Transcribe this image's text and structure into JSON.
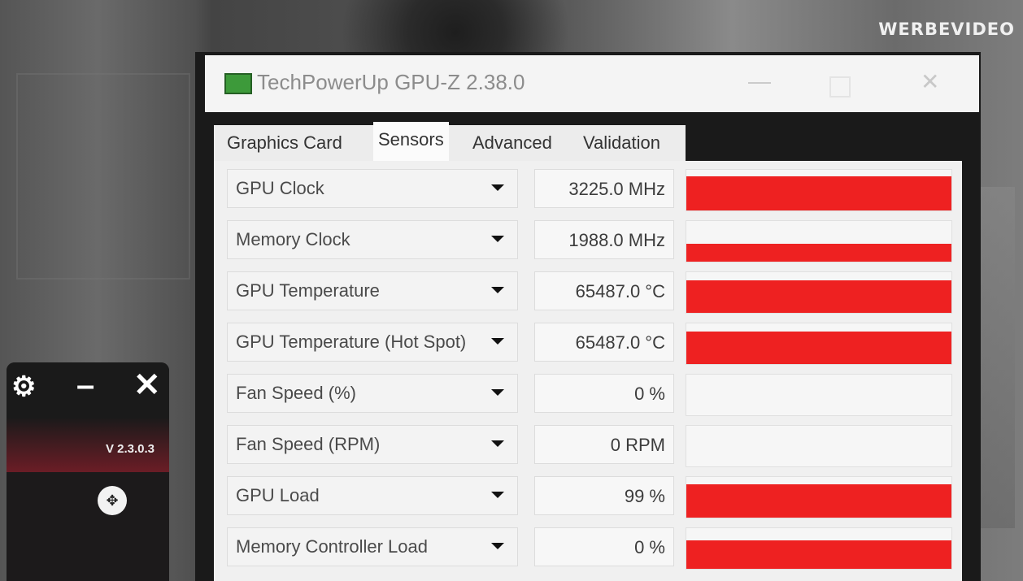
{
  "watermark": "WERBEVIDEO",
  "mini_app": {
    "version": "V 2.3.0.3",
    "accent": "#6b1d26"
  },
  "window": {
    "title": "TechPowerUp GPU-Z 2.38.0",
    "tabs": [
      {
        "label": "Graphics Card",
        "active": false
      },
      {
        "label": "Sensors",
        "active": true
      },
      {
        "label": "Advanced",
        "active": false
      },
      {
        "label": "Validation",
        "active": false
      }
    ]
  },
  "sensor_color": "#ee2121",
  "sensors": [
    {
      "name": "GPU Clock",
      "value": "3225.0 MHz",
      "graph_level": 0.85
    },
    {
      "name": "Memory Clock",
      "value": "1988.0 MHz",
      "graph_level": 0.45
    },
    {
      "name": "GPU Temperature",
      "value": "65487.0 °C",
      "graph_level": 0.8
    },
    {
      "name": "GPU Temperature (Hot Spot)",
      "value": "65487.0 °C",
      "graph_level": 0.8
    },
    {
      "name": "Fan Speed (%)",
      "value": "0 %",
      "graph_level": 0
    },
    {
      "name": "Fan Speed (RPM)",
      "value": "0 RPM",
      "graph_level": 0
    },
    {
      "name": "GPU Load",
      "value": "99 %",
      "graph_level": 0.82
    },
    {
      "name": "Memory Controller Load",
      "value": "0 %",
      "graph_level": 0.7
    }
  ]
}
